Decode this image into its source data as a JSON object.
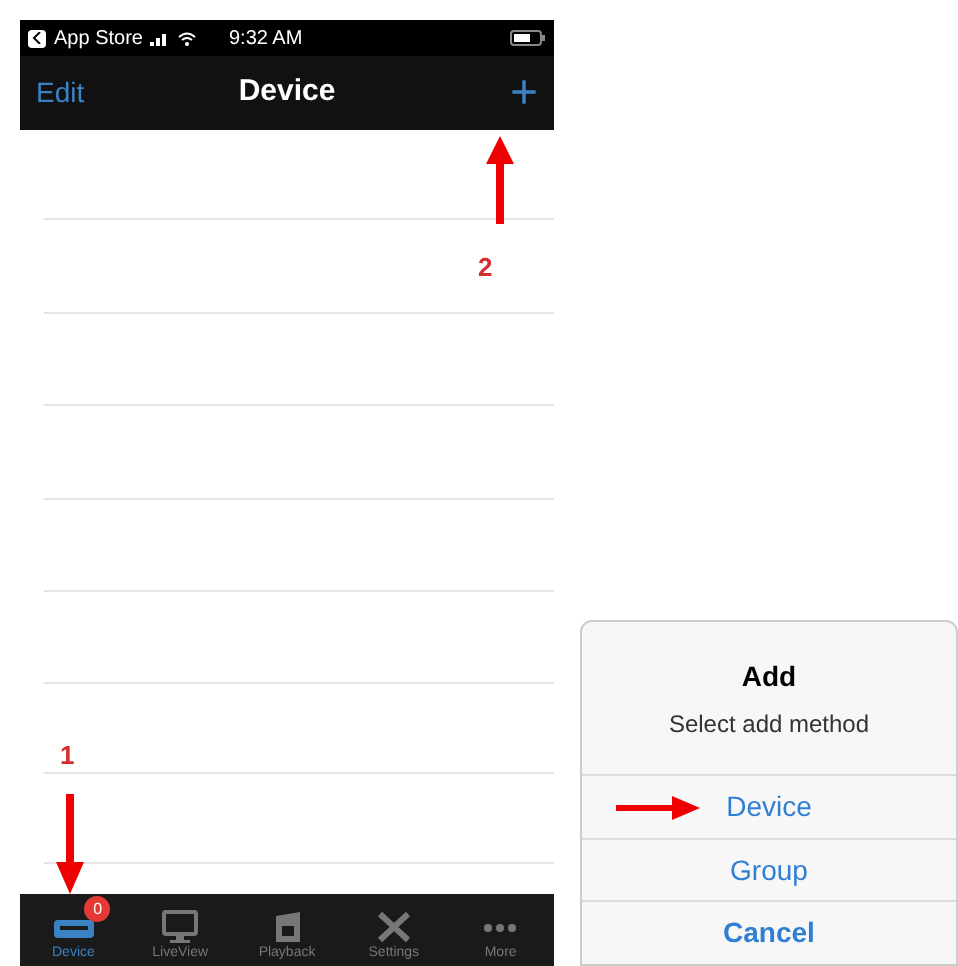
{
  "status_bar": {
    "back_app": "App Store",
    "time": "9:32 AM"
  },
  "nav_bar": {
    "left": "Edit",
    "title": "Device",
    "right": "+"
  },
  "annotations": [
    {
      "label": "2",
      "kind": "up"
    },
    {
      "label": "1",
      "kind": "down"
    }
  ],
  "tab_bar": {
    "tabs": [
      {
        "label": "Device",
        "kind": "device",
        "selected": true,
        "badge": "0"
      },
      {
        "label": "LiveView",
        "kind": "monitor",
        "selected": false
      },
      {
        "label": "Playback",
        "kind": "playback",
        "selected": false
      },
      {
        "label": "Settings",
        "kind": "tools",
        "selected": false
      },
      {
        "label": "More",
        "kind": "more",
        "selected": false
      }
    ]
  },
  "action_sheet": {
    "title": "Add",
    "message": "Select add method",
    "actions": [
      {
        "label": "Device",
        "kind": "default",
        "pointed": true
      },
      {
        "label": "Group",
        "kind": "default",
        "pointed": false
      },
      {
        "label": "Cancel",
        "kind": "cancel",
        "pointed": false
      }
    ]
  }
}
